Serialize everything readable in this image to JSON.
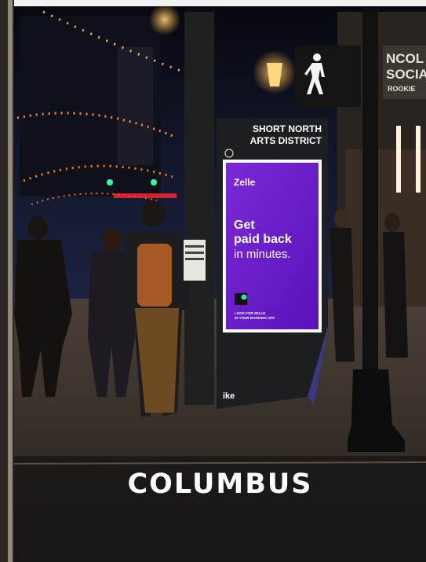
{
  "caption": "COLUMBUS",
  "kiosk": {
    "district_line1": "SHORT NORTH",
    "district_line2": "ARTS DISTRICT",
    "brand": "ike"
  },
  "ad": {
    "brand": "Zelle",
    "headline_line1": "Get",
    "headline_line2": "paid back",
    "headline_line3": "in minutes.",
    "fine_line1": "LOOK FOR ZELLE",
    "fine_line2": "IN YOUR BANKING APP",
    "background_color": "#6b1fc9"
  },
  "storefront_sign": {
    "line1": "NCOL",
    "line2": "SOCIA",
    "line3": "ROOKIE"
  },
  "colors": {
    "night_sky": "#0e1220",
    "sidewalk": "#3a332c",
    "accent_purple": "#6b1fc9"
  }
}
